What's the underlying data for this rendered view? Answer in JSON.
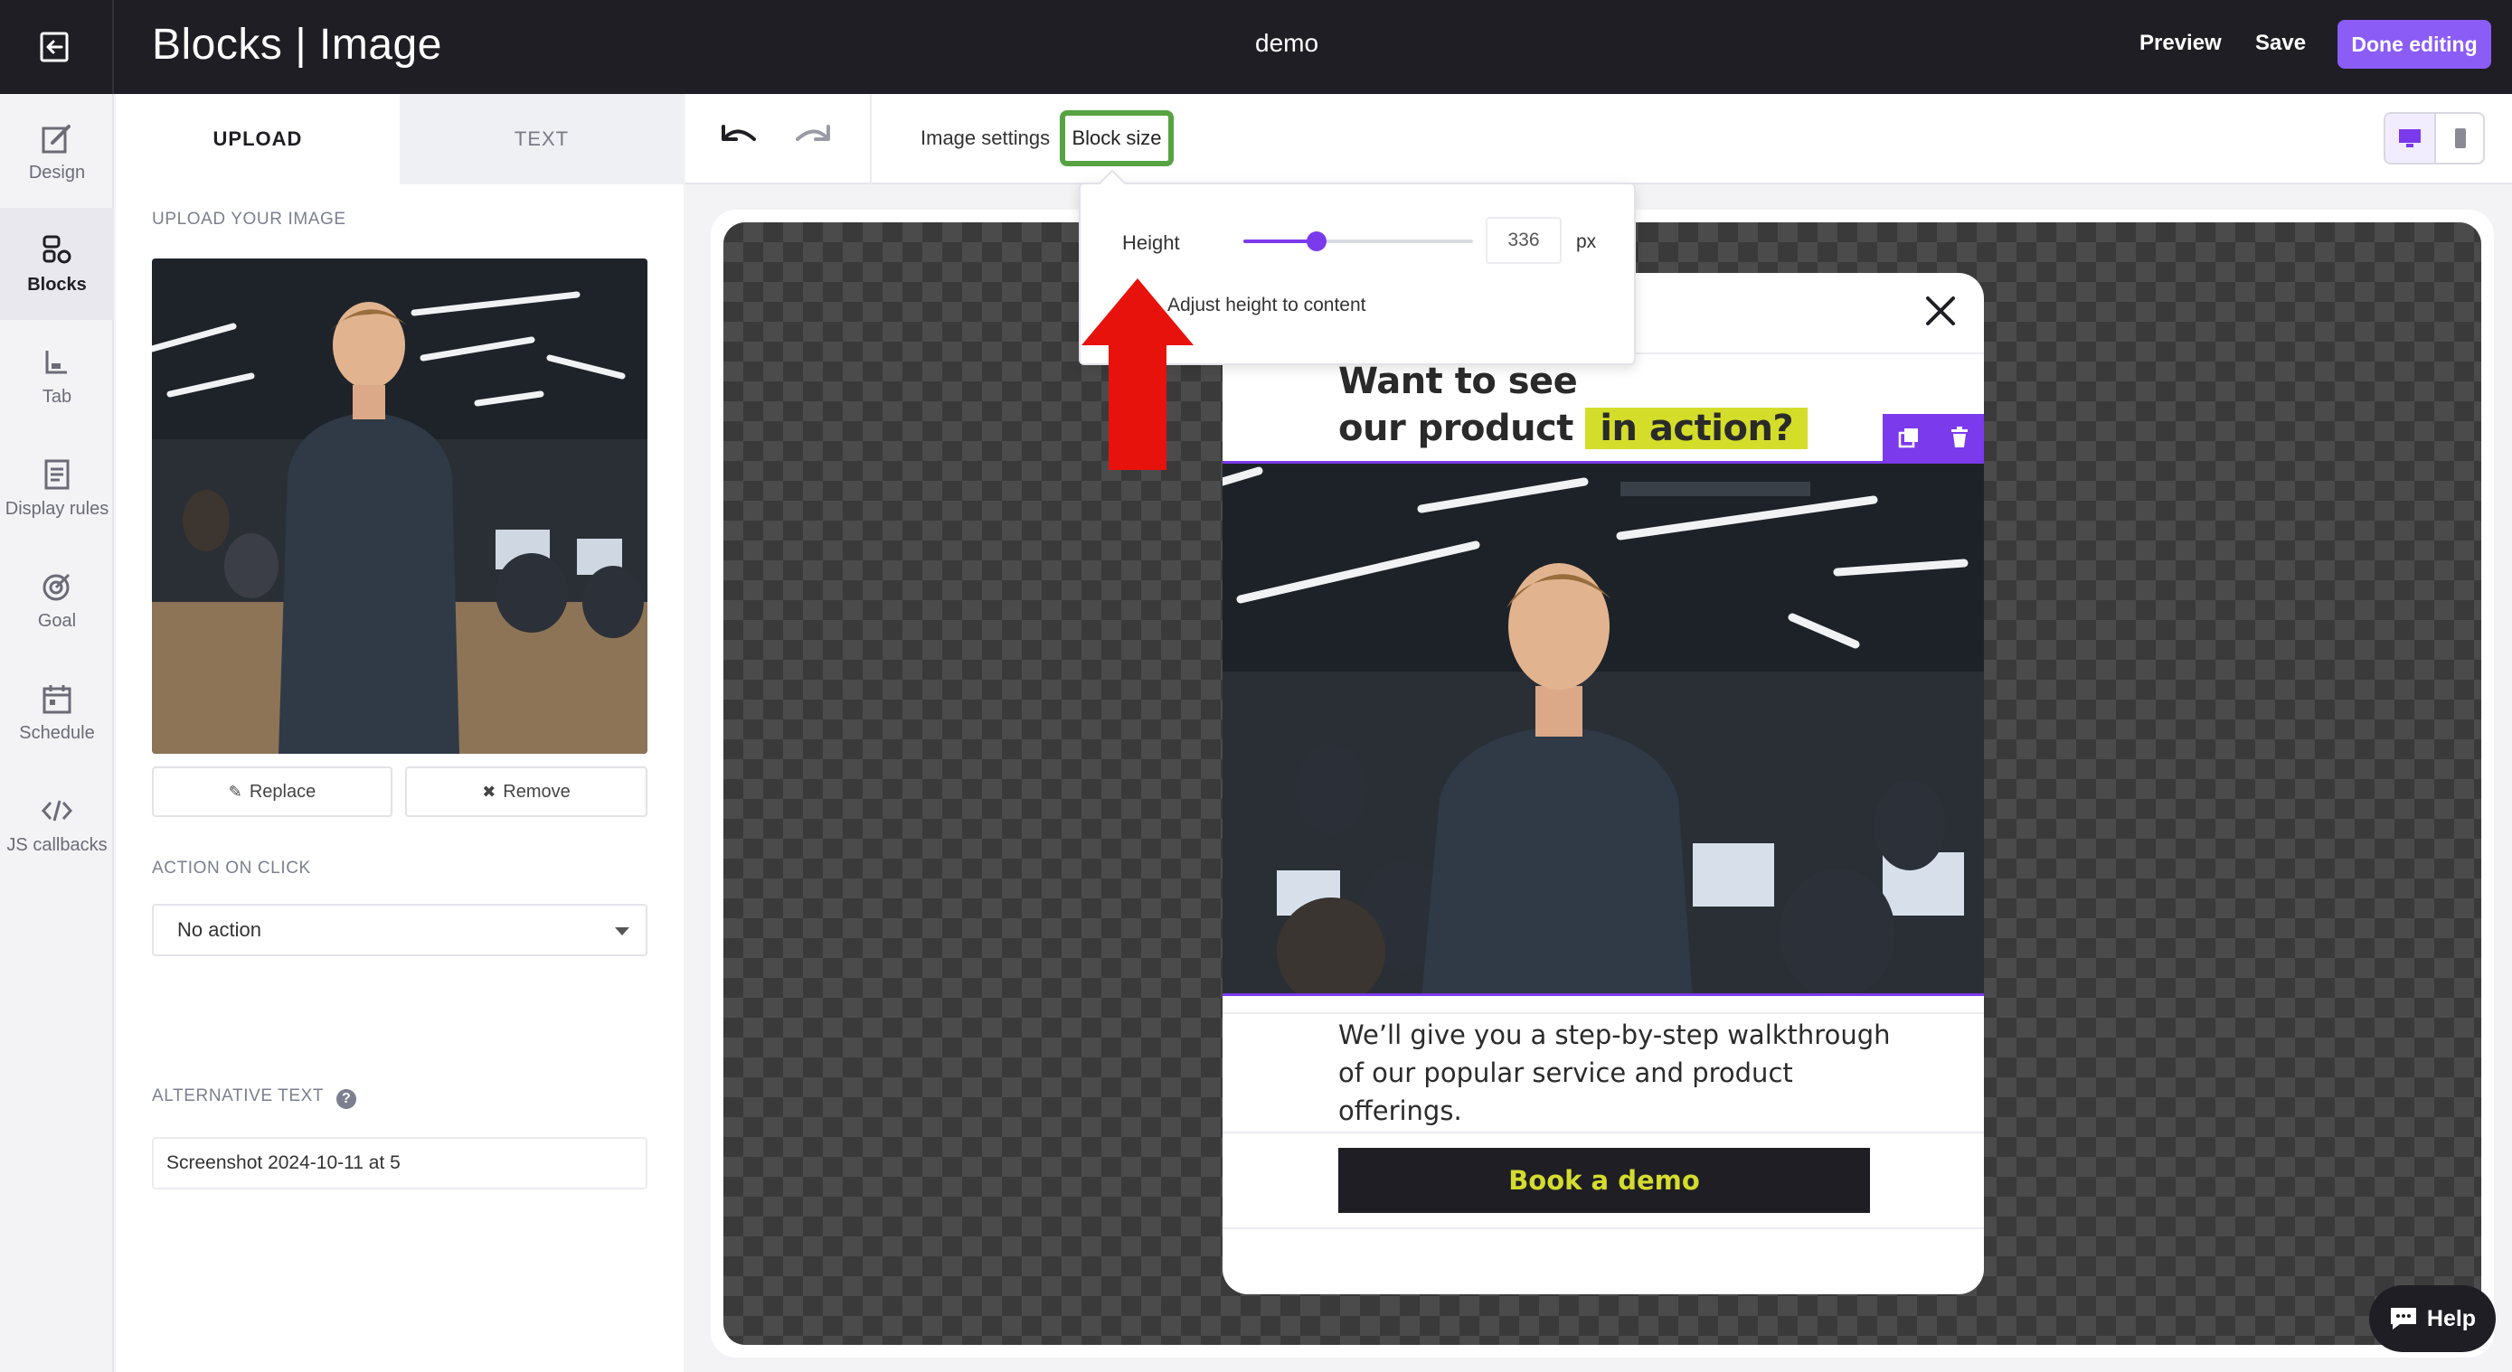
{
  "topbar": {
    "title": "Blocks | Image",
    "campaign": "demo",
    "preview": "Preview",
    "save": "Save",
    "done": "Done editing"
  },
  "rail": {
    "items": [
      {
        "label": "Design",
        "icon": "design-icon",
        "active": false
      },
      {
        "label": "Blocks",
        "icon": "blocks-icon",
        "active": true
      },
      {
        "label": "Tab",
        "icon": "tab-icon",
        "active": false
      },
      {
        "label": "Display rules",
        "icon": "display-rules-icon",
        "active": false
      },
      {
        "label": "Goal",
        "icon": "goal-icon",
        "active": false
      },
      {
        "label": "Schedule",
        "icon": "schedule-icon",
        "active": false
      },
      {
        "label": "JS callbacks",
        "icon": "code-icon",
        "active": false
      }
    ]
  },
  "panel": {
    "tabs": [
      {
        "label": "UPLOAD",
        "active": true
      },
      {
        "label": "TEXT",
        "active": false
      }
    ],
    "upload_label": "UPLOAD YOUR IMAGE",
    "replace": "Replace",
    "remove": "Remove",
    "action_label": "ACTION ON CLICK",
    "action_value": "No action",
    "alt_label": "ALTERNATIVE TEXT",
    "alt_value": "Screenshot 2024-10-11 at 5"
  },
  "toolbar": {
    "image_settings": "Image settings",
    "block_size": "Block size"
  },
  "popover": {
    "height_label": "Height",
    "height_value": "336",
    "unit": "px",
    "slider_fraction": 0.32,
    "adjust_label": "Adjust height to content"
  },
  "popup": {
    "headline_line1": "Want to see",
    "headline_line2a": "our product",
    "headline_highlight": "in action?",
    "body": "We’ll give you a step-by-step walkthrough of our popular service and product offerings.",
    "cta": "Book a demo"
  },
  "help": "Help",
  "colors": {
    "accent": "#8b5cf6",
    "highlight": "#d3dd2a",
    "annotation_green": "#57a342",
    "annotation_red": "#e8120c",
    "dark": "#1f1e24"
  }
}
